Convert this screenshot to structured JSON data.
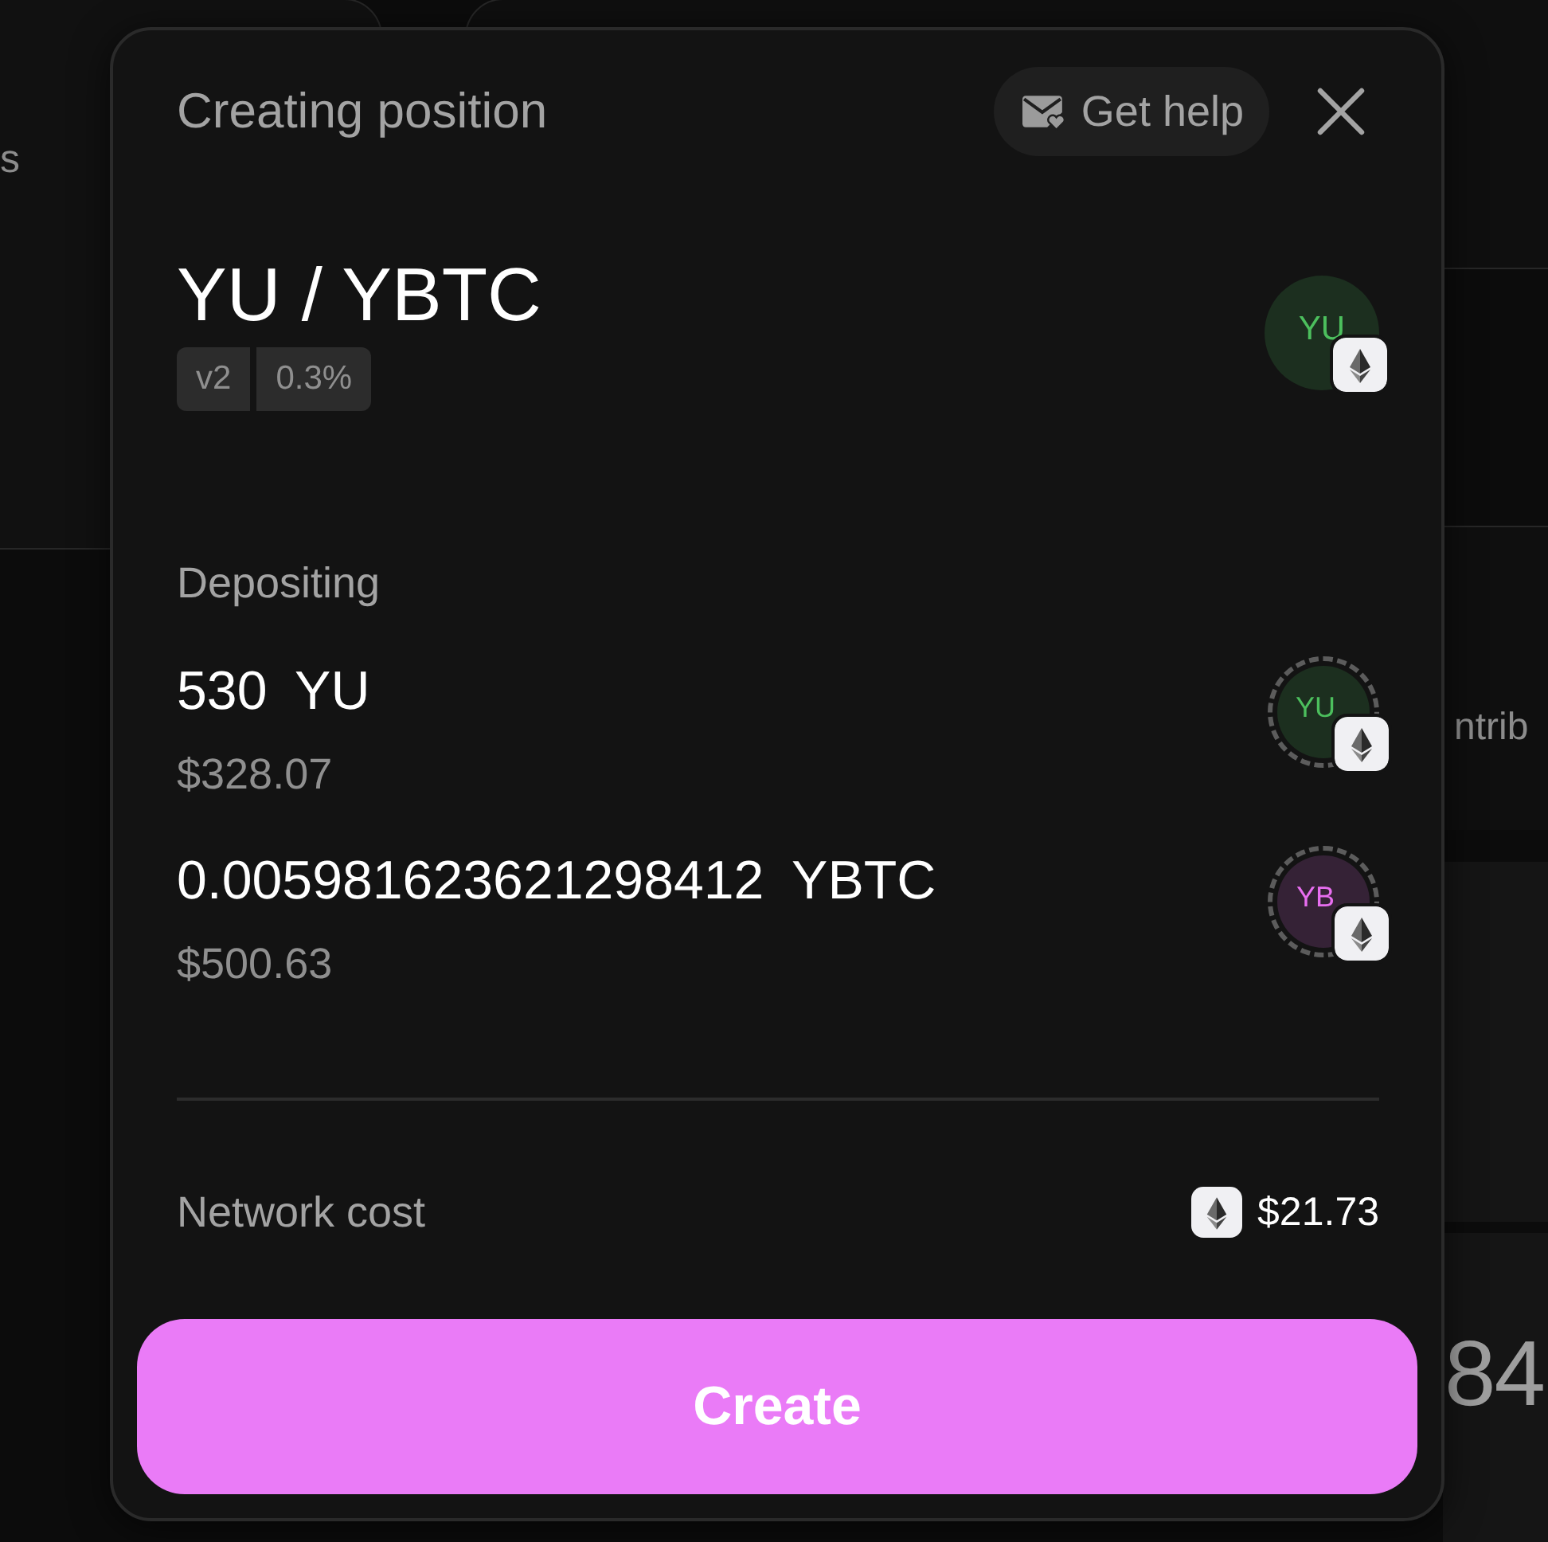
{
  "background_page": {
    "left_panel": {
      "text": "s"
    },
    "side_panel": {
      "text": "ntrib"
    },
    "stat_panel": {
      "value": "84"
    }
  },
  "dialog": {
    "title": "Creating position",
    "help_button": "Get help",
    "pair": {
      "title": "YU / YBTC",
      "tags": [
        "v2",
        "0.3%"
      ],
      "logo": {
        "symbol": "YU",
        "color": "#4cbf5d"
      }
    },
    "depositing_label": "Depositing",
    "deposits": [
      {
        "amount": "530 YU",
        "value": "$328.07",
        "logo": {
          "symbol": "YU",
          "color": "#4cbf5d"
        }
      },
      {
        "amount": "0.005981623621298412 YBTC",
        "value": "$500.63",
        "logo": {
          "symbol": "YB",
          "color": "#e86ef0"
        }
      }
    ],
    "network_cost": {
      "label": "Network cost",
      "value": "$21.73"
    },
    "create_button": "Create"
  }
}
